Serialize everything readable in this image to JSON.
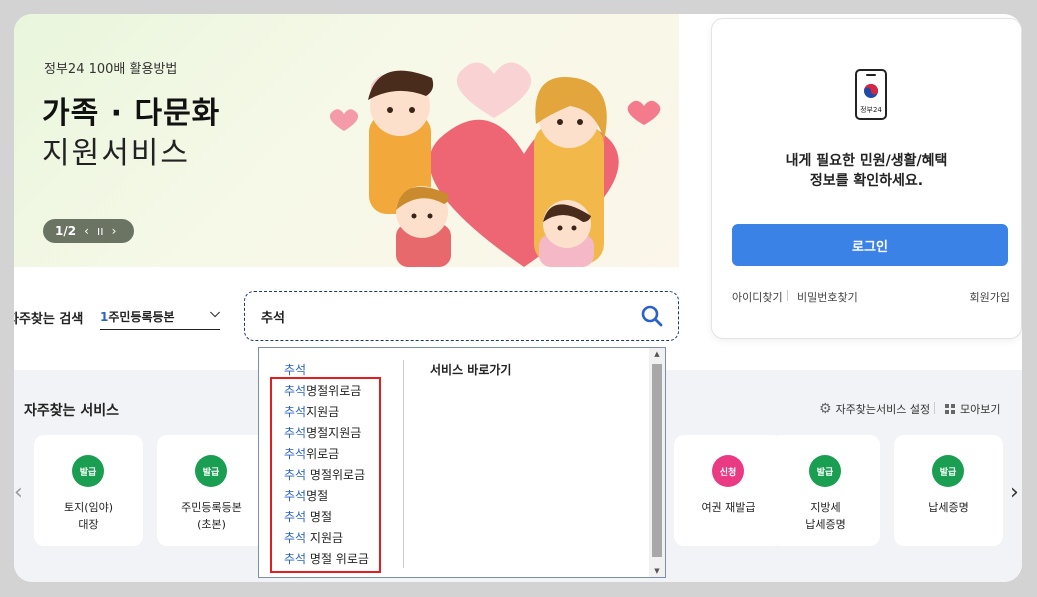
{
  "banner": {
    "subtitle": "정부24 100배 활용방법",
    "title_line1": "가족 · 다문화",
    "title_line2": "지원서비스",
    "pager": {
      "page": "1/2",
      "prev": "‹",
      "pause": "ıı",
      "next": "›"
    }
  },
  "login": {
    "phone_caption": "정부24",
    "message_line1": "내게 필요한 민원/생활/혜택",
    "message_line2": "정보를 확인하세요.",
    "button": "로그인",
    "find_id": "아이디찾기",
    "find_pw": "비밀번호찾기",
    "join": "회원가입"
  },
  "search": {
    "label": "자주찾는 검색",
    "frequent_num": "1",
    "frequent_value": "주민등록등본",
    "chevron": "⌵",
    "query": "추석"
  },
  "autocomplete": {
    "items": [
      {
        "hl": "추석",
        "rest": ""
      },
      {
        "hl": "추석",
        "rest": "명절위로금"
      },
      {
        "hl": "추석",
        "rest": "지원금"
      },
      {
        "hl": "추석",
        "rest": "명절지원금"
      },
      {
        "hl": "추석",
        "rest": "위로금"
      },
      {
        "hl": "추석",
        "rest": " 명절위로금"
      },
      {
        "hl": "추석",
        "rest": "명절"
      },
      {
        "hl": "추석",
        "rest": " 명절"
      },
      {
        "hl": "추석",
        "rest": " 지원금"
      },
      {
        "hl": "추석",
        "rest": " 명절 위로금"
      }
    ],
    "shortcut_title": "서비스 바로가기",
    "scroll_up": "▲",
    "scroll_down": "▼"
  },
  "services": {
    "title": "자주찾는 서비스",
    "settings": "자주찾는서비스 설정",
    "view_all": "모아보기",
    "prev": "‹",
    "next": "›",
    "cards": [
      {
        "badge": "발급",
        "badge_color": "#1a9e52",
        "name": "토지(임야)\n대장"
      },
      {
        "badge": "발급",
        "badge_color": "#1a9e52",
        "name": "주민등록등본\n(초본)"
      },
      {
        "badge": "신청",
        "badge_color": "#ea3a83",
        "name": "여권 재발급"
      },
      {
        "badge": "발급",
        "badge_color": "#1a9e52",
        "name": "지방세\n납세증명"
      },
      {
        "badge": "발급",
        "badge_color": "#1a9e52",
        "name": "납세증명"
      }
    ]
  },
  "colors": {
    "accent": "#3b82e6",
    "highlight_box": "#e41e1e",
    "match_text": "#2a62c9"
  }
}
